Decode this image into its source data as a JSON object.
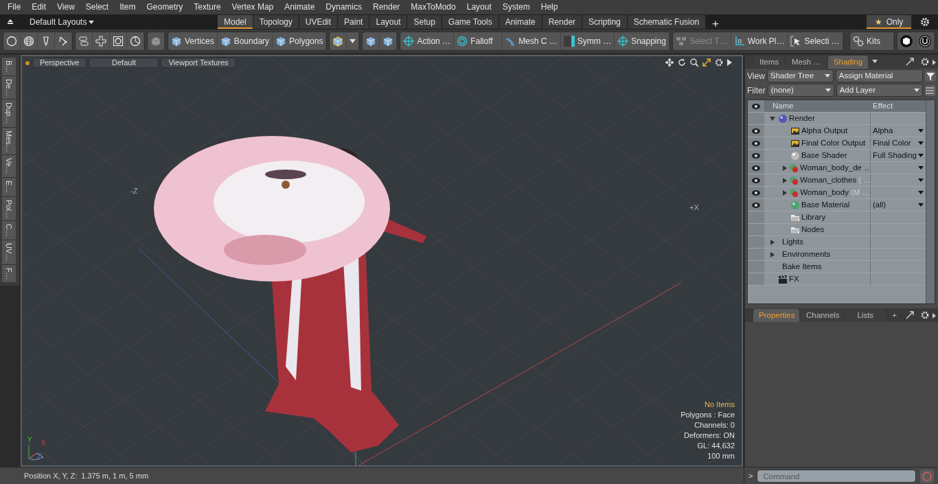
{
  "menu": [
    "File",
    "Edit",
    "View",
    "Select",
    "Item",
    "Geometry",
    "Texture",
    "Vertex Map",
    "Animate",
    "Dynamics",
    "Render",
    "MaxToModo",
    "Layout",
    "System",
    "Help"
  ],
  "layouts": {
    "label": "Default Layouts"
  },
  "layout_tabs": [
    {
      "label": "Model",
      "selected": true
    },
    {
      "label": "Topology",
      "selected": false
    },
    {
      "label": "UVEdit",
      "selected": false
    },
    {
      "label": "Paint",
      "selected": false
    },
    {
      "label": "Layout",
      "selected": false
    },
    {
      "label": "Setup",
      "selected": false
    },
    {
      "label": "Game Tools",
      "selected": false
    },
    {
      "label": "Animate",
      "selected": false
    },
    {
      "label": "Render",
      "selected": false
    },
    {
      "label": "Scripting",
      "selected": false
    },
    {
      "label": "Schematic Fusion",
      "selected": false
    }
  ],
  "add_tab": "+",
  "only_toggle": {
    "glyph": "★",
    "label": "Only",
    "on": true
  },
  "tools": [
    {
      "label": "Vertices",
      "disabled": false
    },
    {
      "label": "Boundary",
      "disabled": false
    },
    {
      "label": "Polygons",
      "disabled": false
    },
    {
      "label": "Action  …",
      "disabled": false
    },
    {
      "label": "Falloff",
      "disabled": false
    },
    {
      "label": "Mesh C …",
      "disabled": false
    },
    {
      "label": "Symm …",
      "disabled": false
    },
    {
      "label": "Snapping",
      "disabled": false
    },
    {
      "label": "Select T…",
      "disabled": true
    },
    {
      "label": "Work Pl…",
      "disabled": false
    },
    {
      "label": "Selecti …",
      "disabled": false
    },
    {
      "label": "Kits",
      "disabled": false
    }
  ],
  "side_tabs": [
    "B…",
    "De…",
    "Dup…",
    "Mes…",
    "Ve…",
    "E…",
    "Pol…",
    "C…",
    "UV…",
    "F…"
  ],
  "viewport": {
    "buttons": [
      "Perspective",
      "Default",
      "Viewport Textures"
    ],
    "axis_labels": [
      "-Z",
      "+X"
    ],
    "gizmo": {
      "y": "Y",
      "x": "X",
      "z": "Z"
    },
    "info": [
      {
        "text": "No Items",
        "highlight": true
      },
      {
        "text": "Polygons : Face",
        "highlight": false
      },
      {
        "text": "Channels: 0",
        "highlight": false
      },
      {
        "text": "Deformers: ON",
        "highlight": false
      },
      {
        "text": "GL: 44,632",
        "highlight": false
      },
      {
        "text": "100 mm",
        "highlight": false
      }
    ]
  },
  "status_bar": {
    "label": "Position X, Y, Z:",
    "value": "1.375 m, 1 m, 5 mm"
  },
  "panel_tabs": [
    {
      "label": "Items",
      "selected": false
    },
    {
      "label": "Mesh …",
      "selected": false
    },
    {
      "label": "Shading",
      "selected": true
    }
  ],
  "view_row": {
    "label": "View",
    "select": "Shader Tree",
    "button": "Assign Material"
  },
  "filter_row": {
    "label": "Filter",
    "select": "(none)",
    "button": "Add Layer"
  },
  "tree": {
    "columns": [
      "Name",
      "Effect"
    ],
    "rows": [
      {
        "kind": "render",
        "name": "Render",
        "visible": false,
        "expanded": true,
        "children": [
          {
            "kind": "image",
            "name": "Alpha Output",
            "effect": "Alpha",
            "visible": true
          },
          {
            "kind": "image",
            "name": "Final Color Output",
            "effect": "Final Color",
            "visible": true
          },
          {
            "kind": "shader",
            "name": "Base Shader",
            "effect": "Full Shading",
            "visible": true
          },
          {
            "kind": "mask",
            "name": "Woman_body_de …",
            "visible": true,
            "expanded": false
          },
          {
            "kind": "mask",
            "name": "Woman_clothes",
            "note": "( …",
            "visible": true,
            "expanded": false
          },
          {
            "kind": "mask",
            "name": "Woman_body",
            "note": "(M …",
            "visible": true,
            "expanded": false
          },
          {
            "kind": "material",
            "name": "Base Material",
            "effect": "(all)",
            "visible": true
          },
          {
            "kind": "folder",
            "name": "Library",
            "visible": false
          },
          {
            "kind": "folder",
            "name": "Nodes",
            "visible": false
          }
        ]
      },
      {
        "kind": "group",
        "name": "Lights",
        "visible": false,
        "expanded": false
      },
      {
        "kind": "group",
        "name": "Environments",
        "visible": false,
        "expanded": false
      },
      {
        "kind": "plain",
        "name": "Bake Items",
        "visible": false
      },
      {
        "kind": "fx",
        "name": "FX",
        "visible": false
      }
    ]
  },
  "bottom_tabs": [
    {
      "label": "Properties",
      "selected": true
    },
    {
      "label": "Channels",
      "selected": false
    },
    {
      "label": "Lists",
      "selected": false
    }
  ],
  "bottom_add": "+",
  "command": {
    "prompt": ">",
    "placeholder": "Command"
  }
}
